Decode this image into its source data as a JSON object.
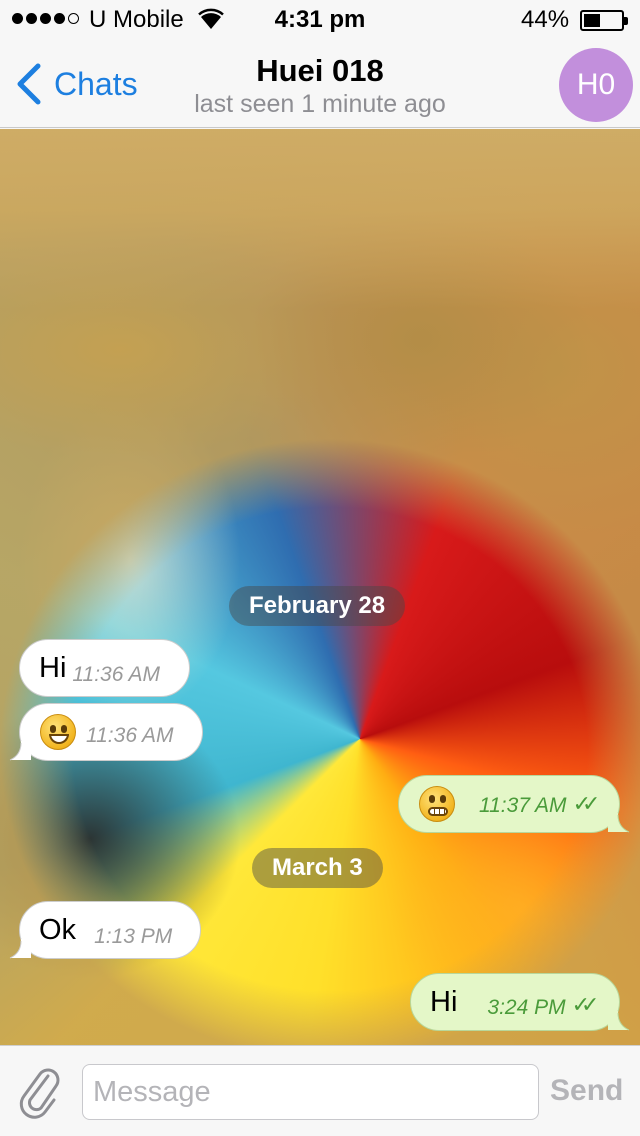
{
  "status_bar": {
    "carrier": "U Mobile",
    "time": "4:31 pm",
    "battery_percent": "44%",
    "battery_level": 0.44,
    "signal_bars": 4,
    "signal_total": 5
  },
  "nav": {
    "back_label": "Chats",
    "title": "Huei 018",
    "subtitle": "last seen 1 minute ago",
    "avatar_initials": "H0",
    "accent_color": "#1d7fe0",
    "avatar_color": "#c28fdc"
  },
  "chat": {
    "date_separators": [
      "February 28",
      "March 3"
    ],
    "messages": [
      {
        "direction": "incoming",
        "text": "Hi",
        "time": "11:36 AM"
      },
      {
        "direction": "incoming",
        "emoji": "grinning-face",
        "time": "11:36 AM"
      },
      {
        "direction": "outgoing",
        "emoji": "grimacing-face",
        "time": "11:37 AM",
        "read": true
      },
      {
        "direction": "incoming",
        "text": "Ok",
        "time": "1:13 PM"
      },
      {
        "direction": "outgoing",
        "text": "Hi",
        "time": "3:24 PM",
        "read": true
      }
    ]
  },
  "input": {
    "placeholder": "Message",
    "send_label": "Send"
  }
}
